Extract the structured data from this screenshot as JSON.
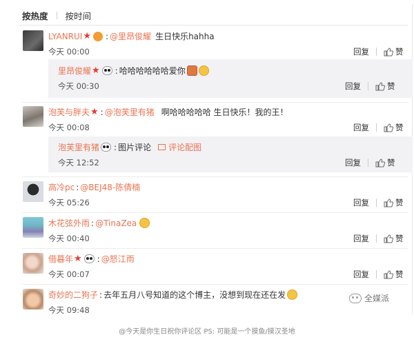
{
  "tabs": {
    "hot": "按热度",
    "time": "按时间"
  },
  "actions": {
    "reply": "回复",
    "like": "赞"
  },
  "comments": [
    {
      "user": "LYANRUI",
      "mention": "@里昂俊耀",
      "text": "生日快乐hahha",
      "time": "今天 00:00"
    },
    {
      "user": "里昂俊耀",
      "text": "哈哈哈哈哈哈爱你",
      "time": "今天 00:30"
    },
    {
      "user": "泡芙与胖夫",
      "mention": "@泡芙里有猪",
      "text": "啊哈哈哈哈哈 生日快乐！我的王！",
      "time": "今天 00:08"
    },
    {
      "user": "泡芙里有猪",
      "text": "图片评论",
      "link": "评论配图",
      "time": "今天 12:52"
    },
    {
      "user": "高冷pc",
      "mention": "@BEJ48-陈倩楠",
      "time": "今天 05:26"
    },
    {
      "user": "木花弦外雨",
      "mention": "@TinaZea",
      "time": "今天 00:40"
    },
    {
      "user": "借暮年",
      "mention": "@怒江雨",
      "time": "今天 00:07"
    },
    {
      "user": "奇妙的二狗子",
      "text": "去年五月八号知道的这个博主，没想到现在还在发",
      "time": "今天 09:48"
    }
  ],
  "watermark": "全媒派",
  "caption": "@今天是你生日祝你评论区 PS: 可能是一个摸鱼/摸汉圣地",
  "colors": {
    "username": "#eb7350",
    "reply_bg": "#f2f2f5",
    "star": "#e8392f"
  }
}
